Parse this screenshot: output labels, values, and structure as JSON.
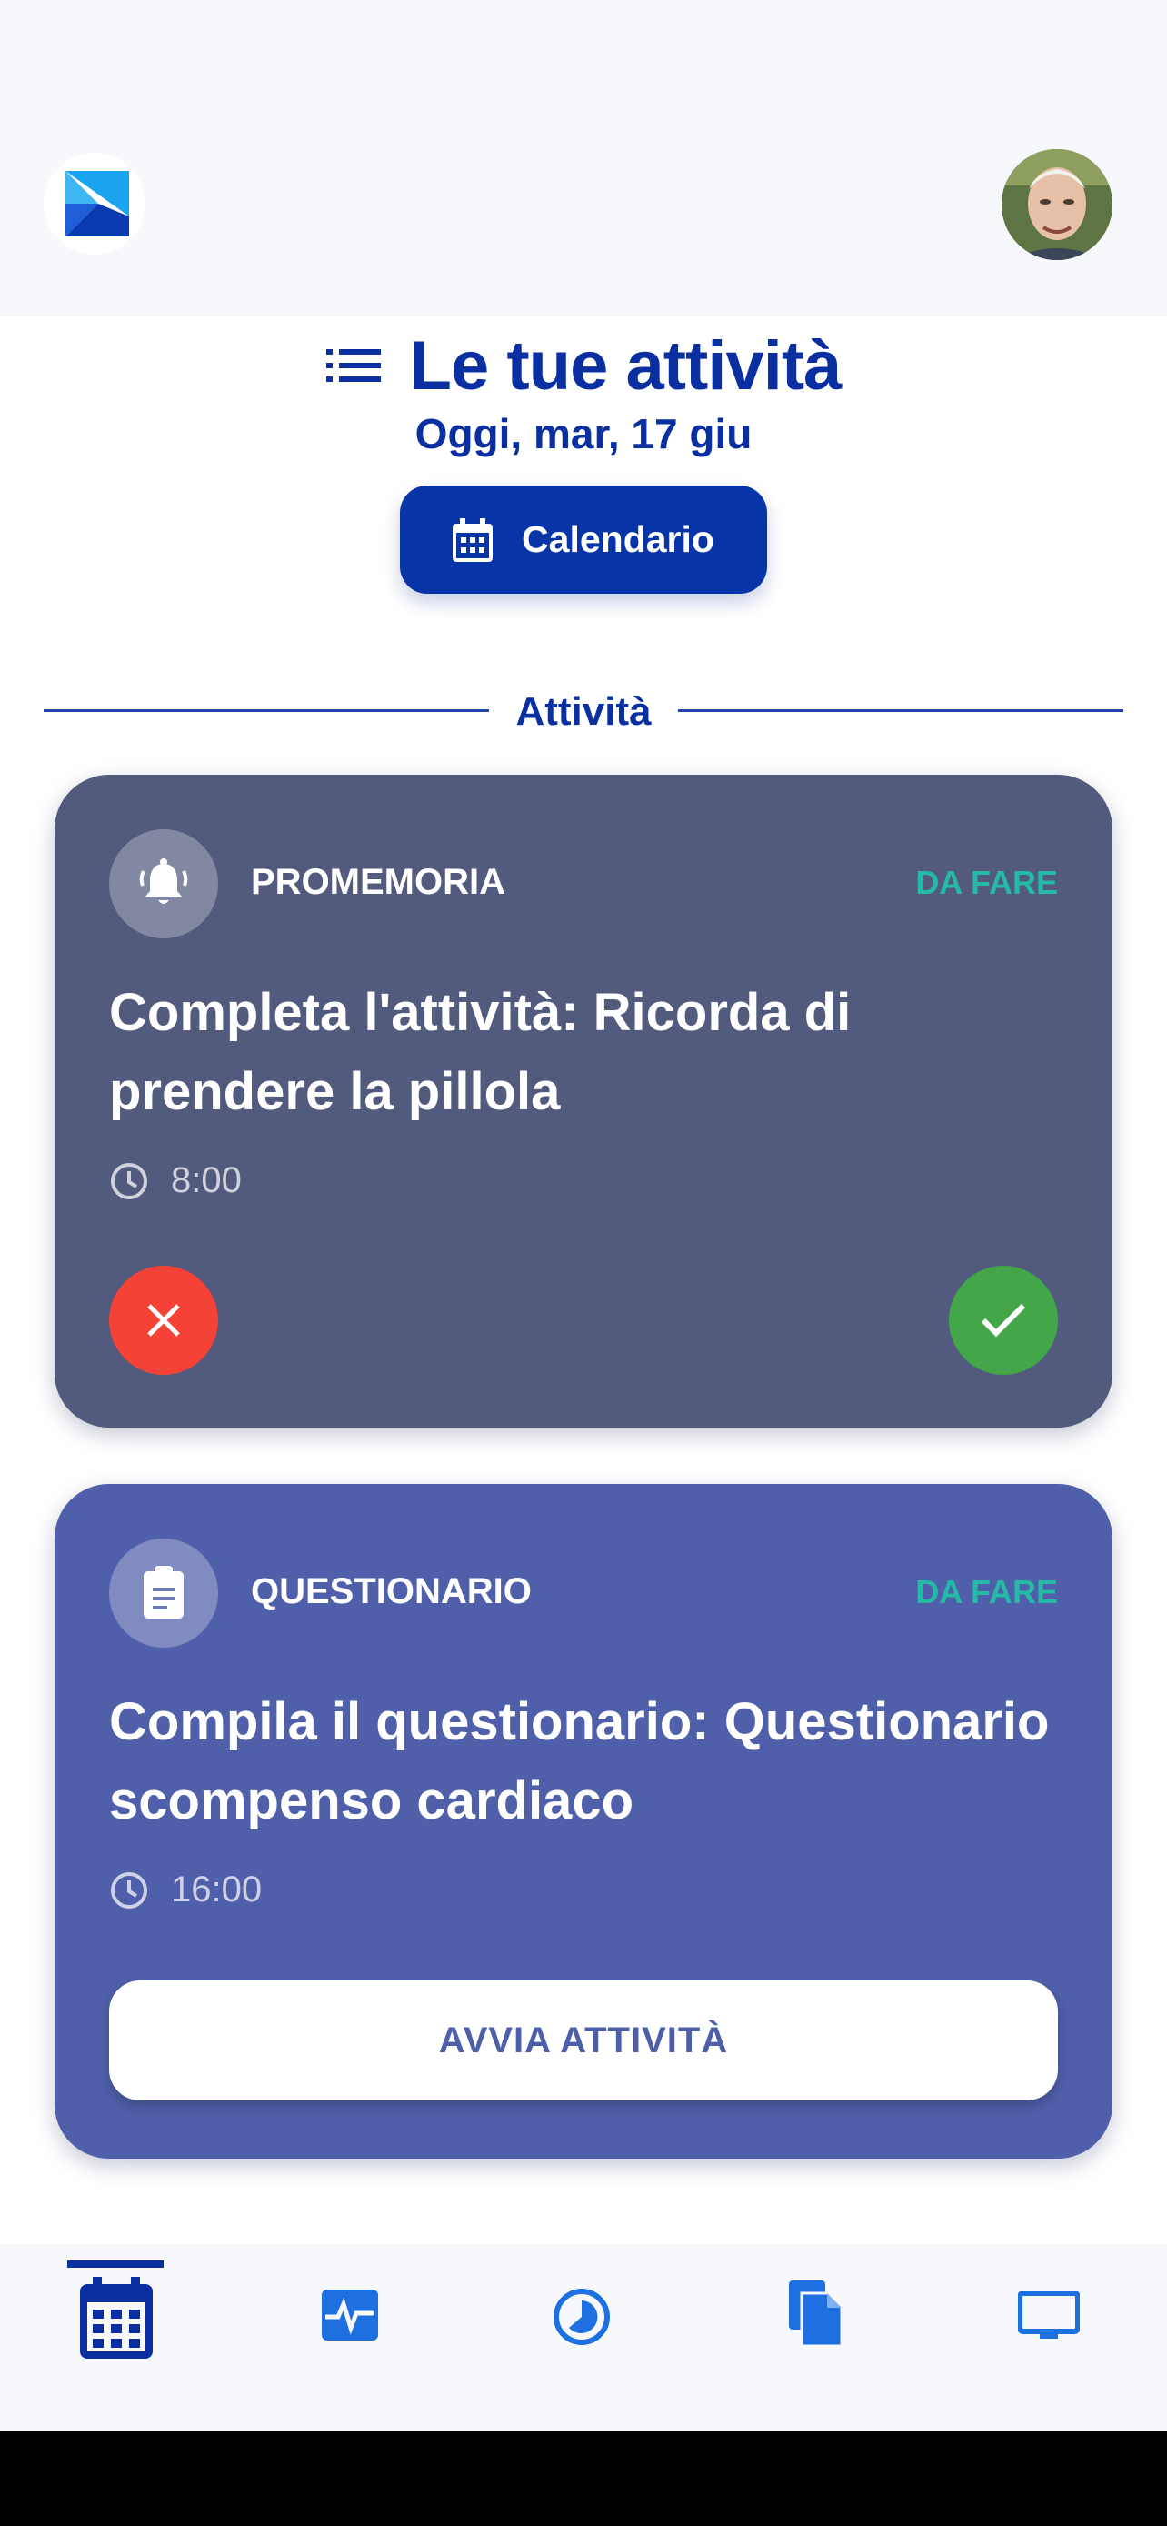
{
  "header": {
    "title": "Le tue attività",
    "date": "Oggi, mar, 17 giu",
    "calendar_button_label": "Calendario"
  },
  "section": {
    "label": "Attività"
  },
  "activities": [
    {
      "type_label": "PROMEMORIA",
      "status": "DA FARE",
      "title": "Completa l'attività: Ricorda di prendere la pillola",
      "time": "8:00",
      "icon": "bell-icon"
    },
    {
      "type_label": "QUESTIONARIO",
      "status": "DA FARE",
      "title": "Compila il questionario: Questionario scompenso cardiaco",
      "time": "16:00",
      "icon": "clipboard-icon",
      "action_label": "AVVIA ATTIVITÀ"
    }
  ],
  "bottom_nav": [
    {
      "icon": "calendar-icon",
      "active": true
    },
    {
      "icon": "activity-icon",
      "active": false
    },
    {
      "icon": "progress-icon",
      "active": false
    },
    {
      "icon": "documents-icon",
      "active": false
    },
    {
      "icon": "monitor-icon",
      "active": false
    }
  ],
  "colors": {
    "primary": "#0a2fa1",
    "reminder_card": "#525b7d",
    "questionnaire_card": "#4f5fa9",
    "status_todo": "#25b9a6",
    "reject": "#f44336",
    "accept": "#43a74a"
  }
}
